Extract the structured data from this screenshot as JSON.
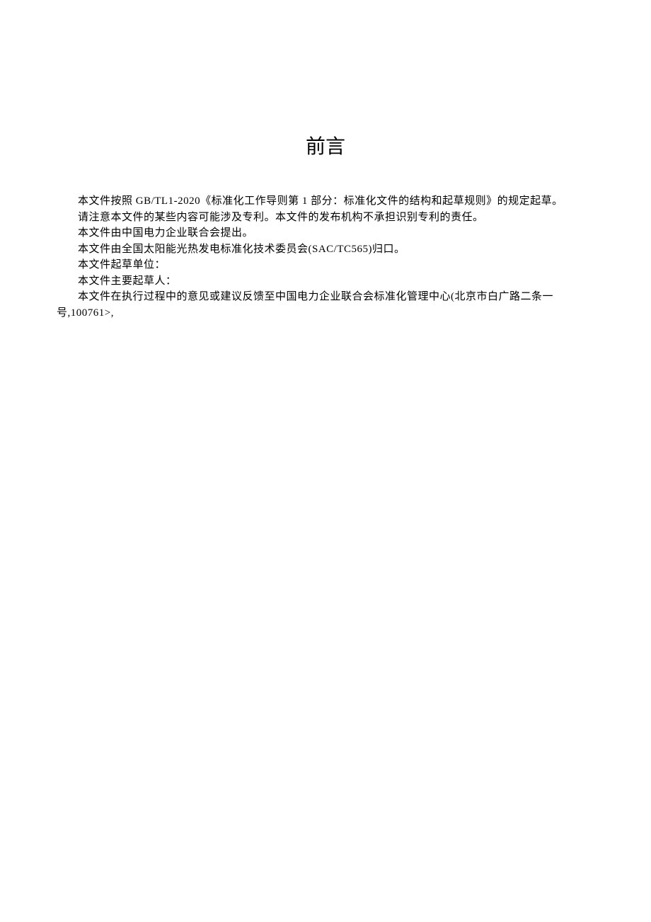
{
  "title": "前言",
  "paragraphs": {
    "p1": "本文件按照 GB/TL1-2020《标准化工作导则第 1 部分：标准化文件的结构和起草规则》的规定起草。",
    "p2": "请注意本文件的某些内容可能涉及专利。本文件的发布机构不承担识别专利的责任。",
    "p3": "本文件由中国电力企业联合会提出。",
    "p4": "本文件由全国太阳能光热发电标准化技术委员会(SAC/TC565)归口。",
    "p5": "本文件起草单位：",
    "p6": "本文件主要起草人：",
    "p7": "本文件在执行过程中的意见或建议反馈至中国电力企业联合会标准化管理中心(北京市白广路二条一",
    "p7_cont": "号,100761>,"
  }
}
